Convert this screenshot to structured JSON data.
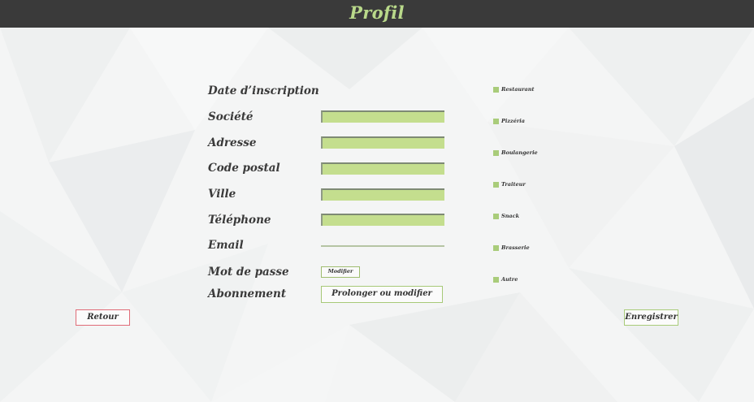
{
  "header": {
    "title": "Profil"
  },
  "form": {
    "labels": {
      "date_inscription": "Date d’inscription",
      "societe": "Société",
      "adresse": "Adresse",
      "code_postal": "Code postal",
      "ville": "Ville",
      "telephone": "Téléphone",
      "email": "Email",
      "mot_de_passe": "Mot de passe",
      "abonnement": "Abonnement"
    },
    "values": {
      "societe": "",
      "adresse": "",
      "code_postal": "",
      "ville": "",
      "telephone": "",
      "email": ""
    },
    "modify_password_label": "Modifier",
    "subscription_button_label": "Prolonger ou modifier"
  },
  "categories": [
    {
      "label": "Restaurant"
    },
    {
      "label": "Pizzéria"
    },
    {
      "label": "Boulangerie"
    },
    {
      "label": "Traiteur"
    },
    {
      "label": "Snack"
    },
    {
      "label": "Brasserie"
    },
    {
      "label": "Autre"
    }
  ],
  "actions": {
    "back_label": "Retour",
    "save_label": "Enregistrer"
  },
  "colors": {
    "header_bg": "#3a3a3a",
    "accent_green": "#c4de8e",
    "back_border": "#e06c78"
  }
}
